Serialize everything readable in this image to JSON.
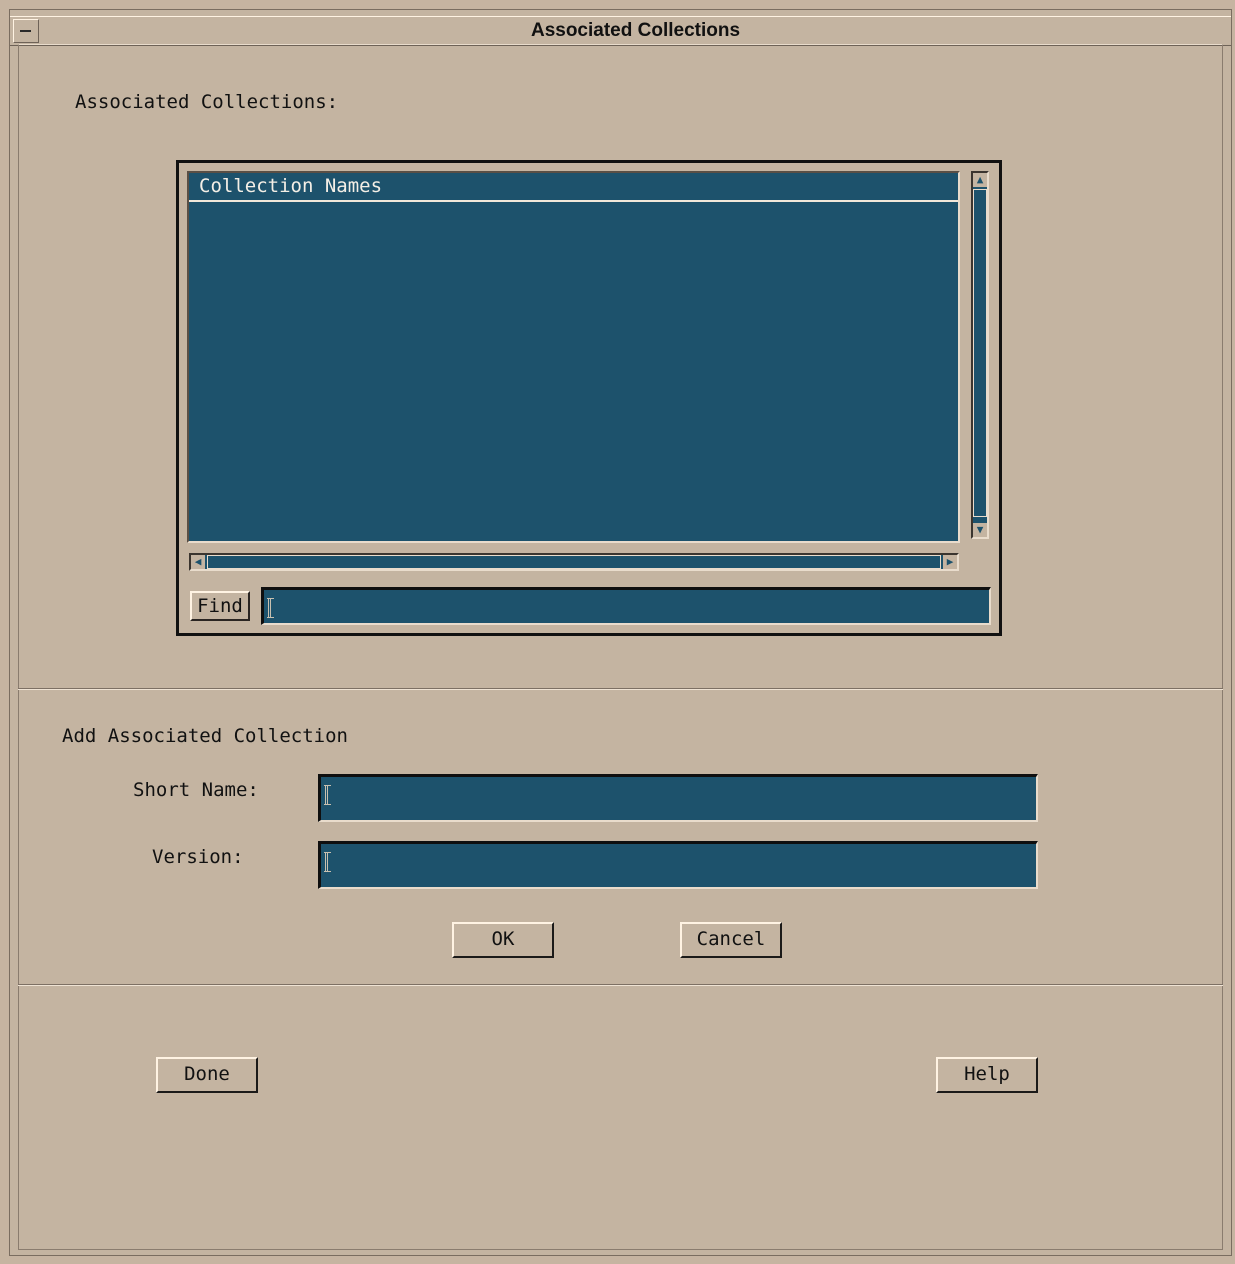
{
  "window": {
    "title": "Associated Collections"
  },
  "associated": {
    "section_label": "Associated Collections:",
    "list_header": "Collection Names",
    "items": [],
    "find_button": "Find",
    "find_value": ""
  },
  "add_section": {
    "title": "Add Associated Collection",
    "short_name_label": "Short Name:",
    "short_name_value": "",
    "version_label": "Version:",
    "version_value": "",
    "ok_button": "OK",
    "cancel_button": "Cancel"
  },
  "footer": {
    "done_button": "Done",
    "help_button": "Help"
  },
  "colors": {
    "background": "#c4b4a1",
    "field": "#1d526c",
    "field_text": "#f4efe6"
  }
}
